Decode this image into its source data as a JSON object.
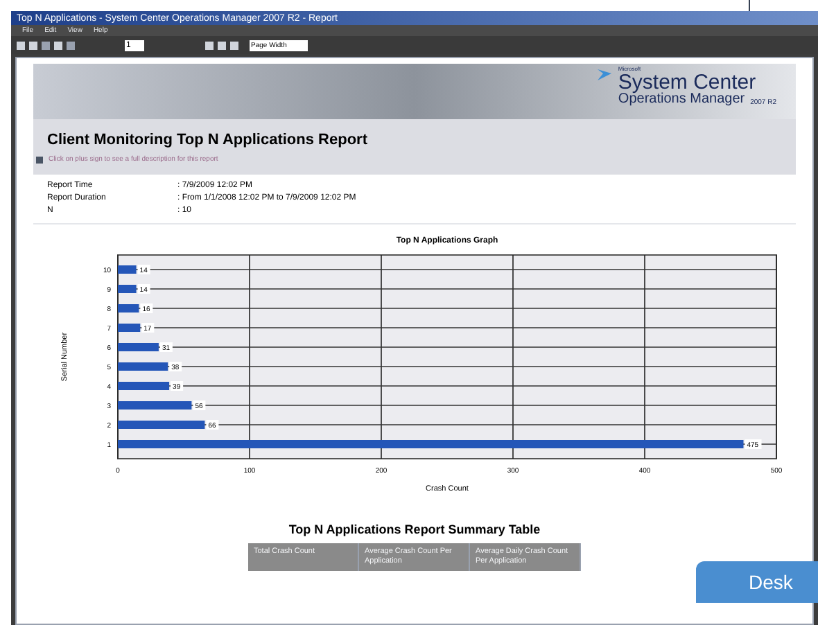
{
  "window": {
    "title": "Top N Applications - System Center Operations Manager 2007 R2 - Report"
  },
  "menu": [
    "File",
    "Edit",
    "View",
    "Help"
  ],
  "toolbar": {
    "page": "1",
    "zoom": "Page Width"
  },
  "logo": {
    "vendor": "Microsoft",
    "product": "System Center",
    "subproduct": "Operations Manager",
    "version": "2007 R2"
  },
  "report": {
    "title": "Client Monitoring Top N Applications Report",
    "description_hint": "Click on plus sign to see a full description for this report",
    "parameters": [
      {
        "label": "Report Time",
        "value": ": 7/9/2009 12:02 PM"
      },
      {
        "label": "Report Duration",
        "value": ": From 1/1/2008 12:02 PM to 7/9/2009 12:02 PM"
      },
      {
        "label": "N",
        "value": ": 10"
      }
    ]
  },
  "chart": {
    "chart_data": {
      "type": "bar",
      "orientation": "horizontal",
      "title": "Top N Applications Graph",
      "xlabel": "Crash Count",
      "ylabel": "Serial Number",
      "categories": [
        "10",
        "9",
        "8",
        "7",
        "6",
        "5",
        "4",
        "3",
        "2",
        "1"
      ],
      "series": [
        {
          "color": "#2456b8",
          "values": [
            14,
            14,
            16,
            17,
            31,
            38,
            39,
            56,
            66,
            475
          ]
        }
      ],
      "xlim": [
        0,
        500
      ],
      "xticks": [
        0,
        100,
        200,
        300,
        400,
        500
      ],
      "grid": true,
      "data_labels": true
    }
  },
  "summary_table": {
    "title": "Top N Applications Report Summary Table",
    "columns": [
      "Total Crash Count",
      "Average Crash Count Per Application",
      "Average Daily Crash Count Per Application"
    ]
  },
  "overlay_button": {
    "label": "Desk"
  }
}
